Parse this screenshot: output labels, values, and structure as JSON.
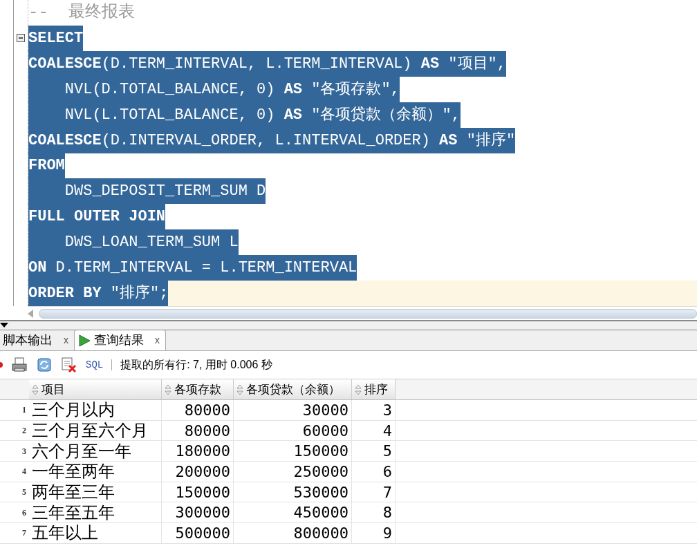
{
  "editor": {
    "lines": [
      {
        "text": "--  最终报表",
        "kind": "comment",
        "selected": false,
        "current": false,
        "fold": false
      },
      {
        "text": "**SELECT**",
        "kind": "code",
        "selected": true,
        "current": false,
        "fold": true
      },
      {
        "text": "    **COALESCE**(D.TERM_INTERVAL, L.TERM_INTERVAL) **AS** \"项目\",",
        "kind": "code",
        "selected": true,
        "current": false,
        "fold": false
      },
      {
        "text": "    NVL(D.TOTAL_BALANCE, 0) **AS** \"各项存款\",",
        "kind": "code",
        "selected": true,
        "current": false,
        "fold": false
      },
      {
        "text": "    NVL(L.TOTAL_BALANCE, 0) **AS** \"各项贷款（余额）\",",
        "kind": "code",
        "selected": true,
        "current": false,
        "fold": false
      },
      {
        "text": "    **COALESCE**(D.INTERVAL_ORDER, L.INTERVAL_ORDER) **AS** \"排序\"",
        "kind": "code",
        "selected": true,
        "current": false,
        "fold": false
      },
      {
        "text": "**FROM**",
        "kind": "code",
        "selected": true,
        "current": false,
        "fold": false
      },
      {
        "text": "    DWS_DEPOSIT_TERM_SUM D",
        "kind": "code",
        "selected": true,
        "current": false,
        "fold": false
      },
      {
        "text": "**FULL OUTER JOIN**",
        "kind": "code",
        "selected": true,
        "current": false,
        "fold": false
      },
      {
        "text": "    DWS_LOAN_TERM_SUM L",
        "kind": "code",
        "selected": true,
        "current": false,
        "fold": false
      },
      {
        "text": "    **ON** D.TERM_INTERVAL = L.TERM_INTERVAL",
        "kind": "code",
        "selected": true,
        "current": false,
        "fold": false
      },
      {
        "text": "**ORDER BY** \"排序\";",
        "kind": "code",
        "selected": true,
        "current": true,
        "fold": false
      }
    ]
  },
  "tabs": [
    {
      "label": "脚本输出",
      "kind": "script",
      "selected": false,
      "close": "x"
    },
    {
      "label": "查询结果",
      "kind": "query",
      "selected": true,
      "close": "x"
    }
  ],
  "toolbar": {
    "sql_label": "SQL",
    "status": "提取的所有行: 7, 用时 0.006 秒"
  },
  "table": {
    "columns": [
      "项目",
      "各项存款",
      "各项贷款（余额）",
      "排序"
    ],
    "rows": [
      {
        "number": "1",
        "cells": [
          "三个月以内",
          "80000",
          "30000",
          "3"
        ]
      },
      {
        "number": "2",
        "cells": [
          "三个月至六个月",
          "80000",
          "60000",
          "4"
        ]
      },
      {
        "number": "3",
        "cells": [
          "六个月至一年",
          "180000",
          "150000",
          "5"
        ]
      },
      {
        "number": "4",
        "cells": [
          "一年至两年",
          "200000",
          "250000",
          "6"
        ]
      },
      {
        "number": "5",
        "cells": [
          "两年至三年",
          "150000",
          "530000",
          "7"
        ]
      },
      {
        "number": "6",
        "cells": [
          "三年至五年",
          "300000",
          "450000",
          "8"
        ]
      },
      {
        "number": "7",
        "cells": [
          "五年以上",
          "500000",
          "800000",
          "9"
        ]
      }
    ]
  }
}
